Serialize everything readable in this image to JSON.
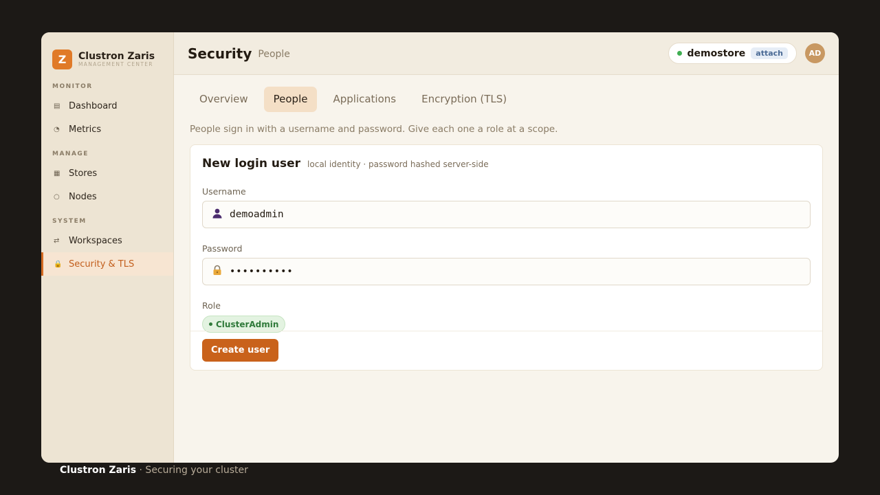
{
  "brand": {
    "logo_letter": "Z",
    "name": "Clustron Zaris",
    "subtitle": "MANAGEMENT CENTER"
  },
  "sidebar": {
    "sections": [
      {
        "title": "MONITOR",
        "items": [
          {
            "label": "Dashboard",
            "icon": "dashboard-icon",
            "glyph": "▤"
          },
          {
            "label": "Metrics",
            "icon": "metrics-icon",
            "glyph": "◔"
          }
        ]
      },
      {
        "title": "MANAGE",
        "items": [
          {
            "label": "Stores",
            "icon": "stores-icon",
            "glyph": "▦"
          },
          {
            "label": "Nodes",
            "icon": "nodes-icon",
            "glyph": "○"
          }
        ]
      },
      {
        "title": "SYSTEM",
        "items": [
          {
            "label": "Workspaces",
            "icon": "workspaces-icon",
            "glyph": "⇄"
          },
          {
            "label": "Security & TLS",
            "icon": "lock-icon",
            "glyph": "🔒",
            "active": true
          }
        ]
      }
    ]
  },
  "header": {
    "title": "Security",
    "subtitle": "People",
    "store": {
      "name": "demostore",
      "badge": "attach",
      "status_color": "#3fae52"
    },
    "avatar": "AD"
  },
  "tabs": [
    {
      "label": "Overview"
    },
    {
      "label": "People",
      "active": true
    },
    {
      "label": "Applications"
    },
    {
      "label": "Encryption (TLS)"
    }
  ],
  "intro": "People sign in with a username and password. Give each one a role at a scope.",
  "form": {
    "title": "New login user",
    "subtitle": "local identity · password hashed server-side",
    "username_label": "Username",
    "username_value": "demoadmin",
    "password_label": "Password",
    "password_masked": "••••••••••",
    "role_label": "Role",
    "role_value": "ClusterAdmin",
    "submit_label": "Create user"
  },
  "caption": {
    "brand": "Clustron Zaris",
    "text": " · Securing your cluster"
  },
  "colors": {
    "accent": "#d46b22",
    "button": "#c9621b",
    "role_green": "#2f7a3a"
  }
}
